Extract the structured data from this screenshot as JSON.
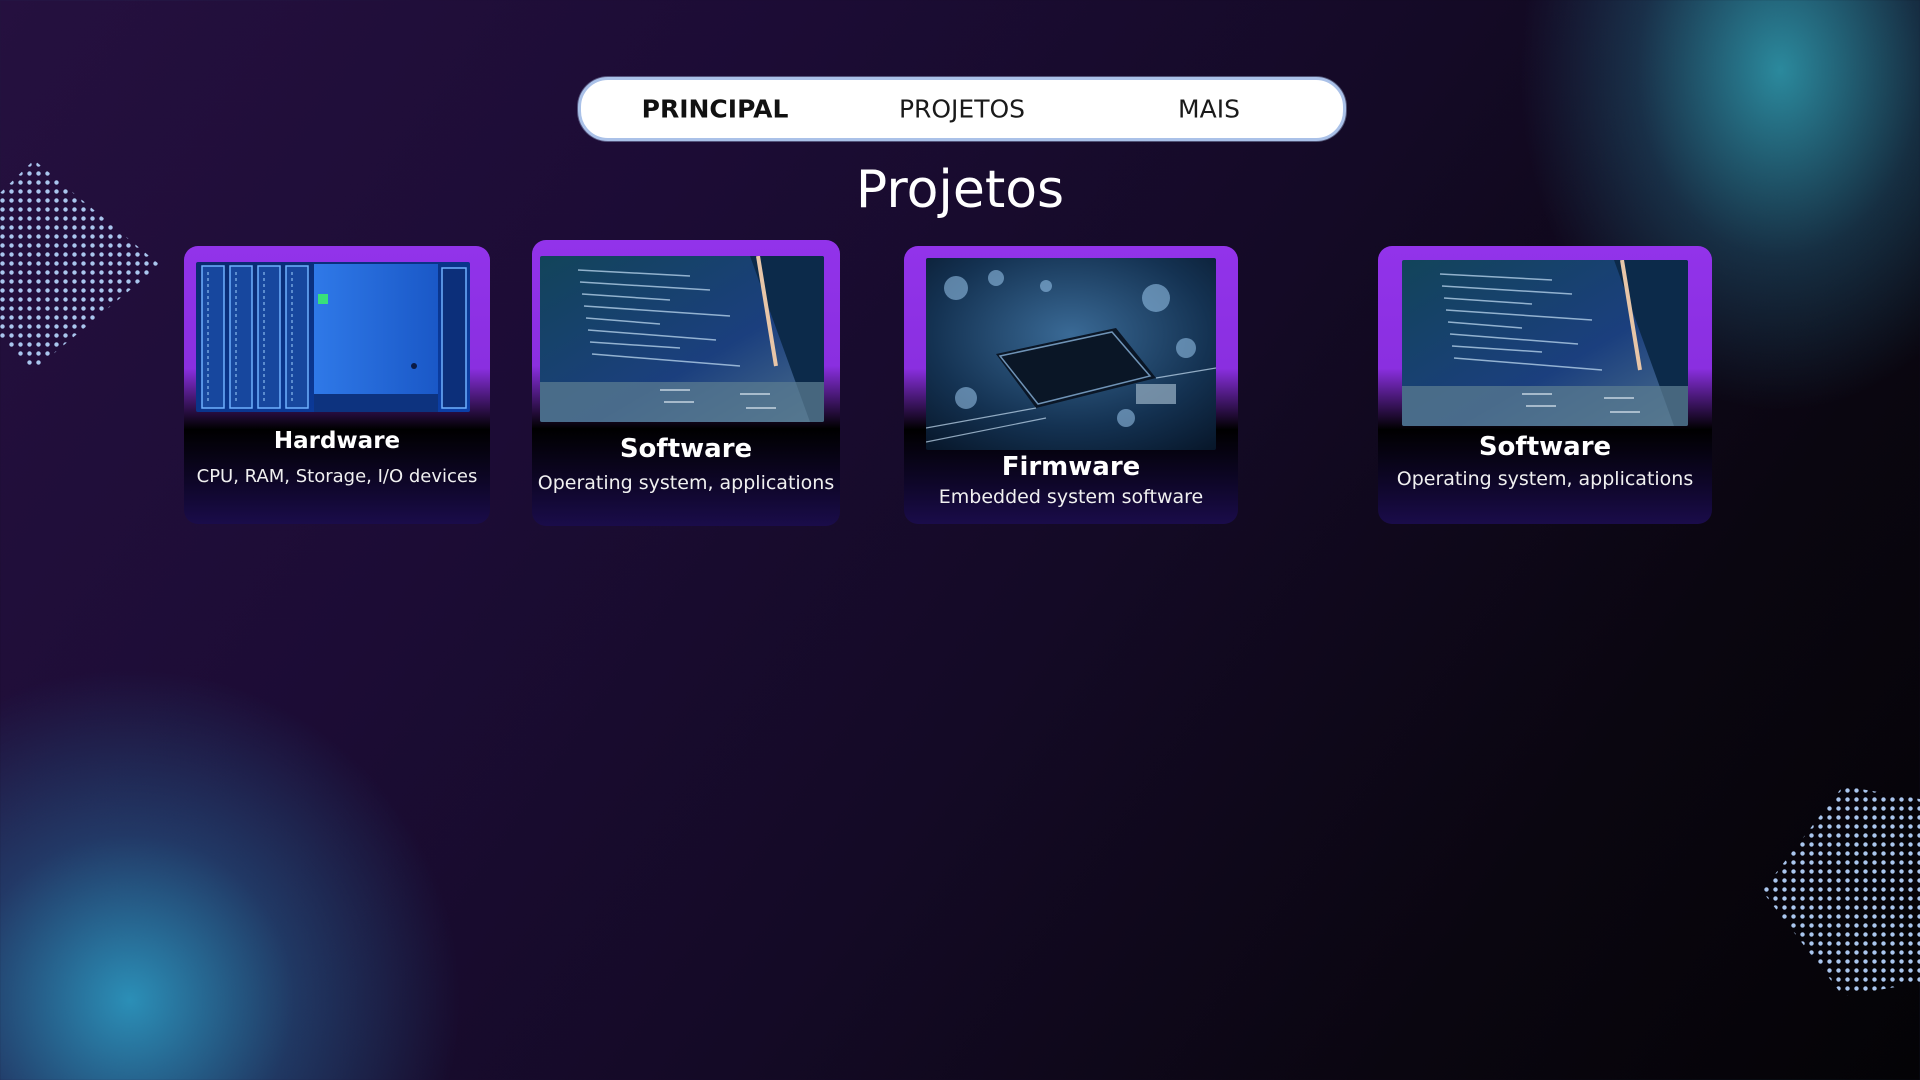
{
  "nav": {
    "items": [
      {
        "label": "PRINCIPAL",
        "active": true
      },
      {
        "label": "PROJETOS",
        "active": false
      },
      {
        "label": "MAIS",
        "active": false
      }
    ]
  },
  "page": {
    "title": "Projetos"
  },
  "cards": [
    {
      "title": "Hardware",
      "description": "CPU, RAM, Storage, I/O devices",
      "image": "server-rack-photo"
    },
    {
      "title": "Software",
      "description": "Operating system, applications",
      "image": "terminal-screen-photo"
    },
    {
      "title": "Firmware",
      "description": "Embedded system software",
      "image": "circuit-board-photo"
    },
    {
      "title": "Software",
      "description": "Operating system, applications",
      "image": "terminal-screen-photo"
    }
  ],
  "colors": {
    "card_accent": "#9233ea",
    "nav_border": "#aac1e8",
    "background_dark": "#1c0c35",
    "glow_teal": "#30a0b4"
  }
}
